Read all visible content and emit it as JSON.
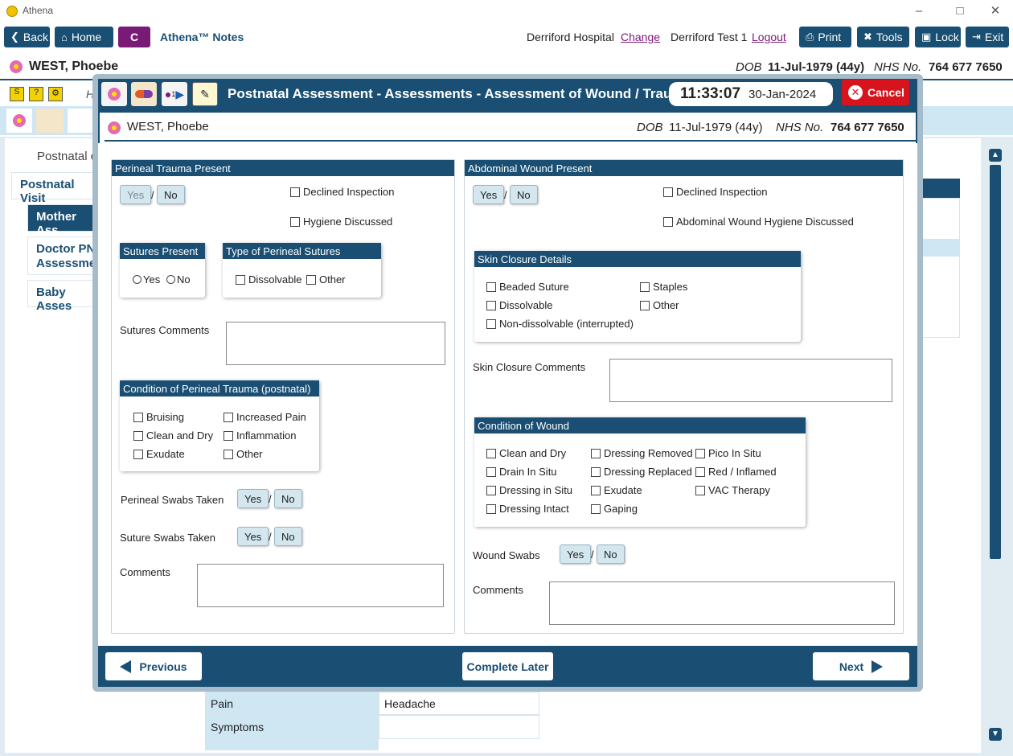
{
  "window": {
    "title": "Athena"
  },
  "toolbar": {
    "back": "Back",
    "home": "Home",
    "c": "C",
    "app_name": "Athena™ Notes",
    "hospital": "Derriford Hospital",
    "change": "Change",
    "user": "Derriford Test 1",
    "logout": "Logout",
    "print": "Print",
    "tools": "Tools",
    "lock": "Lock",
    "exit": "Exit"
  },
  "patient": {
    "name": "WEST, Phoebe",
    "dob_label": "DOB",
    "dob": "11-Jul-1979 (44y)",
    "nhs_label": "NHS No.",
    "nhs": "764 677 7650"
  },
  "background": {
    "nav": [
      "Postnatal Visit",
      "Mother Ass",
      "Doctor PN Assessmen",
      "Baby Asses"
    ],
    "crumb": "Postnatal c",
    "h_label": "H",
    "table": [
      {
        "label": "Pain",
        "value": "Headache"
      },
      {
        "label": "Symptoms",
        "value": ""
      }
    ]
  },
  "modal": {
    "title": "Postnatal Assessment - Assessments - Assessment of Wound / Trauma",
    "time": "11:33:07",
    "date": "30-Jan-2024",
    "cancel": "Cancel",
    "icon_badge": "1",
    "left": {
      "header": "Perineal Trauma Present",
      "yes": "Yes",
      "no": "No",
      "slash": "/",
      "declined": "Declined Inspection",
      "hygiene": "Hygiene Discussed",
      "sutures_present": {
        "title": "Sutures Present",
        "yes": "Yes",
        "no": "No"
      },
      "suture_type": {
        "title": "Type of Perineal Sutures",
        "options": [
          "Dissolvable",
          "Other"
        ]
      },
      "sutures_comments": "Sutures Comments",
      "condition": {
        "title": "Condition of Perineal Trauma (postnatal)",
        "col1": [
          "Bruising",
          "Clean and Dry",
          "Exudate"
        ],
        "col2": [
          "Increased Pain",
          "Inflammation",
          "Other"
        ]
      },
      "perineal_swabs": "Perineal Swabs Taken",
      "suture_swabs": "Suture Swabs Taken",
      "comments": "Comments"
    },
    "right": {
      "header": "Abdominal Wound Present",
      "yes": "Yes",
      "no": "No",
      "declined": "Declined Inspection",
      "hygiene": "Abdominal Wound Hygiene Discussed",
      "skin_closure": {
        "title": "Skin Closure Details",
        "col1": [
          "Beaded Suture",
          "Dissolvable",
          "Non-dissolvable (interrupted)"
        ],
        "col2": [
          "Staples",
          "Other"
        ]
      },
      "skin_comments": "Skin Closure Comments",
      "condition": {
        "title": "Condition of Wound",
        "col1": [
          "Clean and Dry",
          "Drain In Situ",
          "Dressing in Situ",
          "Dressing Intact"
        ],
        "col2": [
          "Dressing Removed",
          "Dressing Replaced",
          "Exudate",
          "Gaping"
        ],
        "col3": [
          "Pico In Situ",
          "Red / Inflamed",
          "VAC Therapy"
        ]
      },
      "wound_swabs": "Wound Swabs",
      "comments": "Comments"
    },
    "footer": {
      "previous": "Previous",
      "complete_later": "Complete Later",
      "next": "Next"
    }
  }
}
